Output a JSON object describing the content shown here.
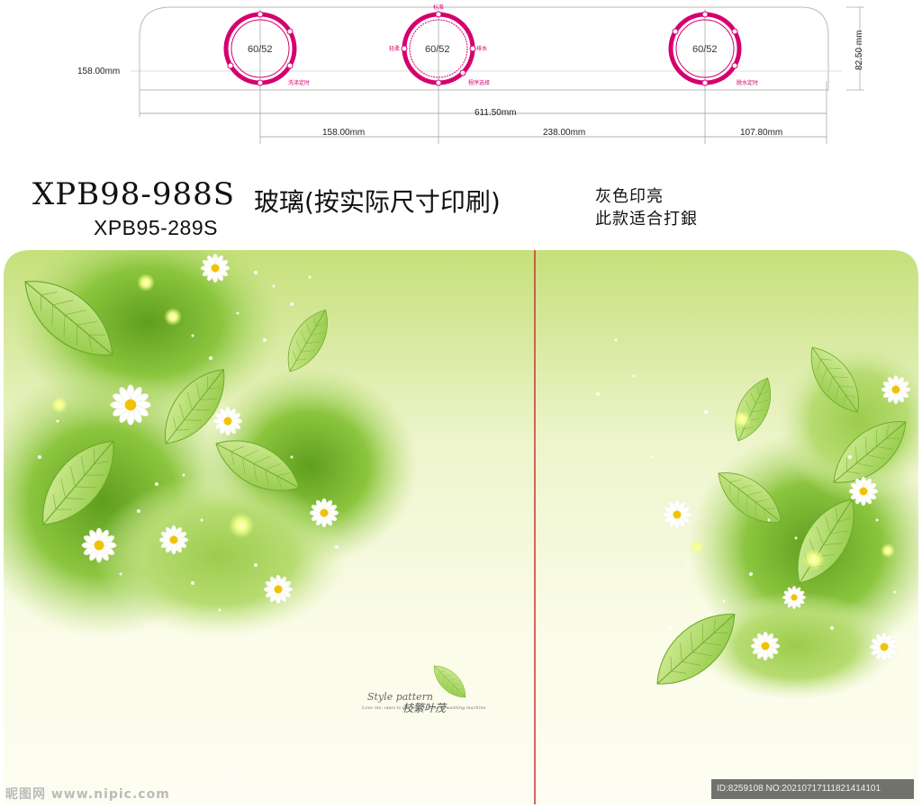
{
  "drawing": {
    "dims": {
      "left_height": "158.00mm",
      "total_width": "611.50mm",
      "seg1": "158.00mm",
      "seg2": "238.00mm",
      "seg3": "107.80mm",
      "panel_height": "82.50 mm"
    },
    "knobs": [
      {
        "value": "60/52",
        "label_right": "洗涤定时"
      },
      {
        "value": "60/52",
        "label_top": "标准",
        "label_left": "轻柔",
        "label_right": "排水",
        "label_bottom_right": "程序选择"
      },
      {
        "value": "60/52",
        "label_right": "脱水定时"
      }
    ],
    "accent_color": "#d4006e"
  },
  "header": {
    "model_primary": "XPB98-988S",
    "title_cn": "玻璃(按实际尺寸印刷)",
    "model_secondary": "XPB95-289S",
    "note_line1": "灰色印亮",
    "note_line2": "此款适合打銀"
  },
  "artwork": {
    "brand_en": "Style pattern",
    "brand_cn": "枝繁叶茂",
    "brand_tiny": "Love me, open to the world / Lots of washing machine",
    "leaf_color": "#8cc63f",
    "fold_line_color": "#d32f2f"
  },
  "footer": {
    "left": "昵图网 www.nipic.com",
    "right": "ID:8259108 NO:20210717111821414101"
  }
}
